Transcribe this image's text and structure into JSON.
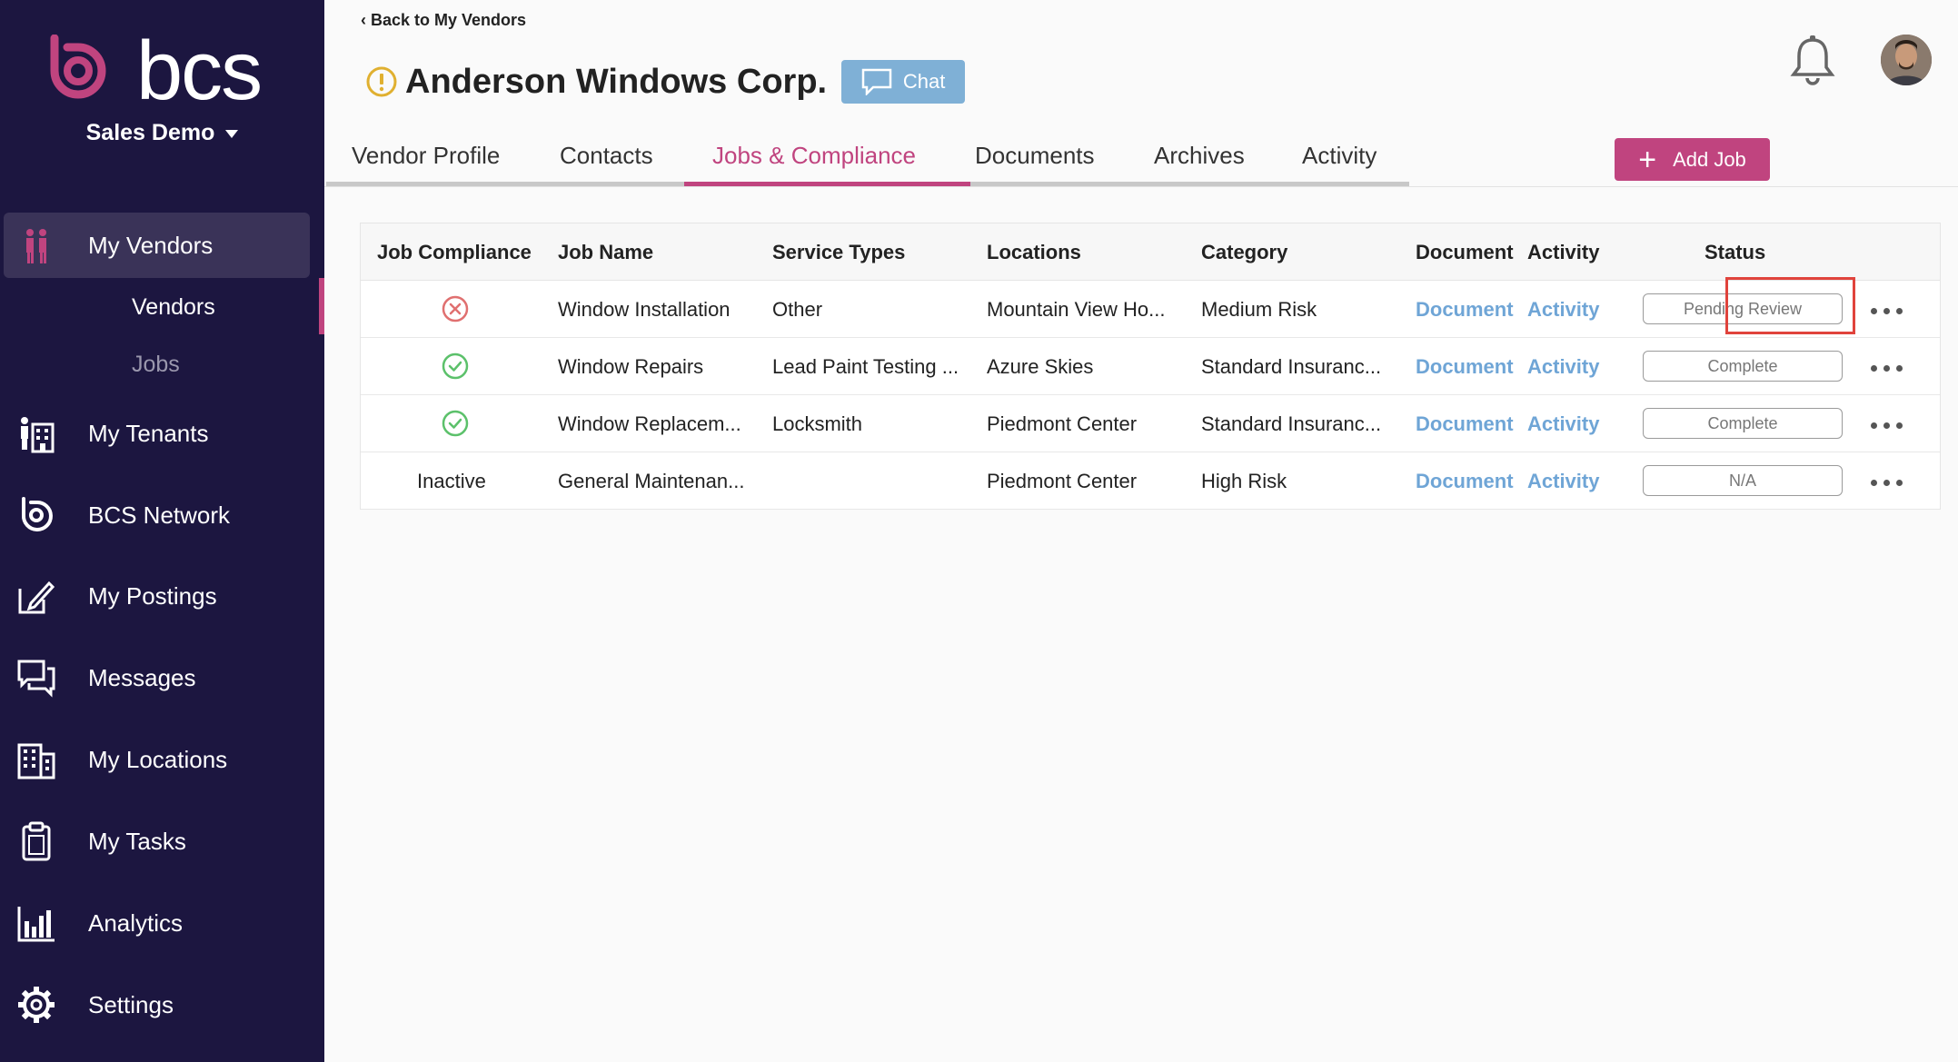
{
  "sidebar": {
    "logo_text": "bcs",
    "account": "Sales Demo",
    "nav": [
      {
        "label": "My Vendors",
        "icon": "vendors-icon"
      },
      {
        "label": "My Tenants",
        "icon": "tenants-icon"
      },
      {
        "label": "BCS Network",
        "icon": "bcs-network-icon"
      },
      {
        "label": "My Postings",
        "icon": "postings-icon"
      },
      {
        "label": "Messages",
        "icon": "messages-icon"
      },
      {
        "label": "My Locations",
        "icon": "locations-icon"
      },
      {
        "label": "My Tasks",
        "icon": "tasks-icon"
      },
      {
        "label": "Analytics",
        "icon": "analytics-icon"
      },
      {
        "label": "Settings",
        "icon": "settings-icon"
      }
    ],
    "sub": [
      {
        "label": "Vendors"
      },
      {
        "label": "Jobs"
      }
    ]
  },
  "header": {
    "back_label": "Back to My Vendors",
    "vendor_name": "Anderson Windows Corp.",
    "chat_label": "Chat",
    "add_job_label": "Add Job"
  },
  "tabs": [
    {
      "label": "Vendor Profile"
    },
    {
      "label": "Contacts"
    },
    {
      "label": "Jobs & Compliance"
    },
    {
      "label": "Documents"
    },
    {
      "label": "Archives"
    },
    {
      "label": "Activity"
    }
  ],
  "table": {
    "headers": [
      "Job Compliance",
      "Job Name",
      "Service Types",
      "Locations",
      "Category",
      "Document",
      "Activity",
      "Status"
    ],
    "rows": [
      {
        "compliance": "error",
        "compliance_text": "",
        "job_name": "Window Installation",
        "service": "Other",
        "location": "Mountain View Ho...",
        "category": "Medium Risk",
        "document": "Document",
        "activity": "Activity",
        "status": "Pending Review"
      },
      {
        "compliance": "ok",
        "compliance_text": "",
        "job_name": "Window Repairs",
        "service": "Lead Paint Testing ...",
        "location": "Azure Skies",
        "category": "Standard Insuranc...",
        "document": "Document",
        "activity": "Activity",
        "status": "Complete"
      },
      {
        "compliance": "ok",
        "compliance_text": "",
        "job_name": "Window Replacem...",
        "service": "Locksmith",
        "location": "Piedmont Center",
        "category": "Standard Insuranc...",
        "document": "Document",
        "activity": "Activity",
        "status": "Complete"
      },
      {
        "compliance": "text",
        "compliance_text": "Inactive",
        "job_name": "General Maintenan...",
        "service": "",
        "location": "Piedmont Center",
        "category": "High Risk",
        "document": "Document",
        "activity": "Activity",
        "status": "N/A"
      }
    ]
  },
  "colors": {
    "sidebar_bg": "#1c1640",
    "accent": "#c0447f",
    "link": "#6fa5d6",
    "chat": "#7fb0d6",
    "ok": "#5cc16b",
    "error": "#e07070",
    "warning": "#e0b030",
    "highlight": "#e0433c"
  }
}
